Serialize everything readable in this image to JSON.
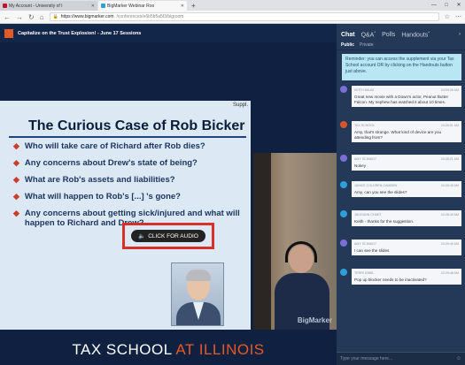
{
  "browser": {
    "tabs": [
      {
        "label": "My Account - University of I",
        "fav": "#c8102e"
      },
      {
        "label": "BigMarker Webinar Roo",
        "fav": "#2f9fd8",
        "active": true
      }
    ],
    "new_tab": "+",
    "url_domain": "https://www.bigmarker.com",
    "url_path": "/conferences/e6b5b5a5f3/bigroom",
    "window_controls": [
      "—",
      "□",
      "✕"
    ]
  },
  "header": {
    "session_title": "Capitalize on the Trust Explosion! - June 17 Sessions"
  },
  "slide": {
    "suppl": "Suppl.",
    "title": "The Curious Case of Rob Bicker",
    "bullets": [
      "Who will take care of Richard after Rob dies?",
      "Any concerns about Drew's state of being?",
      "What are Rob's assets and liabilities?",
      "What will happen to Rob's [...] 's gone?",
      "Any concerns about getting sick/injured and what will happen to Richard and Drew?"
    ],
    "audio_button": "CLICK FOR AUDIO"
  },
  "video": {
    "watermark": "BigMarker"
  },
  "brand": {
    "part1": "TAX SCHOOL",
    "part2": "AT ILLINOIS"
  },
  "chat": {
    "tabs": [
      {
        "label": "Chat",
        "active": true,
        "badge": ""
      },
      {
        "label": "Q&A",
        "badge": "•"
      },
      {
        "label": "Polls",
        "badge": ""
      },
      {
        "label": "Handouts",
        "badge": "•"
      }
    ],
    "subtabs": [
      "Public",
      "Private"
    ],
    "reminder": "Reminder: you can access the supplement via your Tax School account OR by clicking on the Handouts button just above.",
    "messages": [
      {
        "author": "KEITH BAUM",
        "time": "10:09:28 am",
        "text": "Great new movie with a Down's actor, Peanut Butter Falcon. My nephew has watched it about 10 times.",
        "color": "#7b6fd6"
      },
      {
        "author": "Tax School",
        "time": "10:28:01 am",
        "text": "Amy, that's strange. What kind of device are you attending from?",
        "color": "#d8542f"
      },
      {
        "author": "AMY SCHMIDT",
        "time": "10:28:21 am",
        "text": "Nokey",
        "color": "#7b6fd6"
      },
      {
        "author": "JANICE COLDREN-CAMDEN",
        "time": "10:28:45 am",
        "text": "Amy, can you see the slides?",
        "color": "#2f9fd8"
      },
      {
        "author": "JULIEANN CHAET",
        "time": "10:28:49 am",
        "text": "Keith - thanks for the suggestion.",
        "color": "#2f9fd8"
      },
      {
        "author": "AMY SCHMIDT",
        "time": "10:29:40 am",
        "text": "I can see the slides",
        "color": "#7b6fd6"
      },
      {
        "author": "TERRI IOBEL",
        "time": "10:29:48 am",
        "text": "Pop up blocker needs to be inactivated?",
        "color": "#2f9fd8"
      }
    ],
    "input_placeholder": "Type your message here...",
    "emoji": "☺"
  }
}
